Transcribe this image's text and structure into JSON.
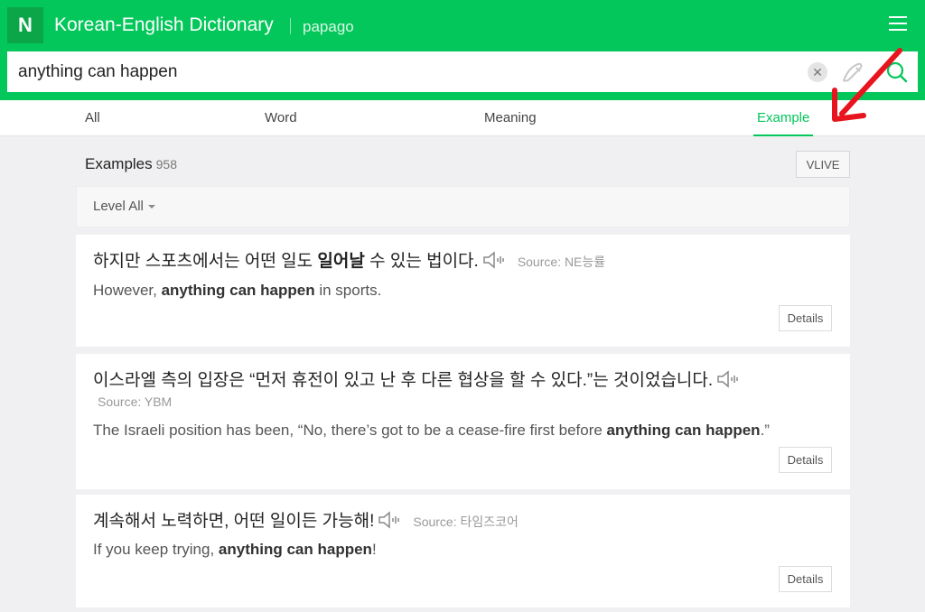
{
  "header": {
    "logo": "N",
    "title": "Korean-English Dictionary",
    "brand": "papago",
    "menu_icon": "hamburger-icon"
  },
  "search": {
    "value": "anything can happen",
    "clear_icon": "close-icon",
    "handwriting_icon": "pen-icon",
    "search_icon": "search-icon"
  },
  "tabs": [
    {
      "label": "All",
      "active": false
    },
    {
      "label": "Word",
      "active": false
    },
    {
      "label": "Meaning",
      "active": false
    },
    {
      "label": "Example",
      "active": true
    }
  ],
  "colors": {
    "brand_green": "#03c75a",
    "annotation_arrow": "#e8141e"
  },
  "examples": {
    "title": "Examples",
    "count": "958",
    "vlive_label": "VLIVE",
    "level_label": "Level All",
    "items": [
      {
        "kor_before": "하지만 스포츠에서는 어떤 일도 ",
        "kor_bold": "일어날",
        "kor_after": " 수 있는 법이다.",
        "source": "Source: NE능률",
        "eng_before": "However, ",
        "eng_bold": "anything can happen",
        "eng_after": " in sports.",
        "details_label": "Details"
      },
      {
        "kor_before": "이스라엘 측의 입장은 “먼저 휴전이 있고 난 후 다른 협상을 할 수 있다.”는 것이었습니다.",
        "kor_bold": "",
        "kor_after": "",
        "source": "Source: YBM",
        "eng_before": "The Israeli position has been, “No, there’s got to be a cease-fire first before ",
        "eng_bold": "anything can happen",
        "eng_after": ".”",
        "details_label": "Details"
      },
      {
        "kor_before": "계속해서 노력하면, 어떤 일이든 가능해!",
        "kor_bold": "",
        "kor_after": "",
        "source": "Source: 타임즈코어",
        "eng_before": "If you keep trying, ",
        "eng_bold": "anything can happen",
        "eng_after": "!",
        "details_label": "Details"
      }
    ]
  }
}
